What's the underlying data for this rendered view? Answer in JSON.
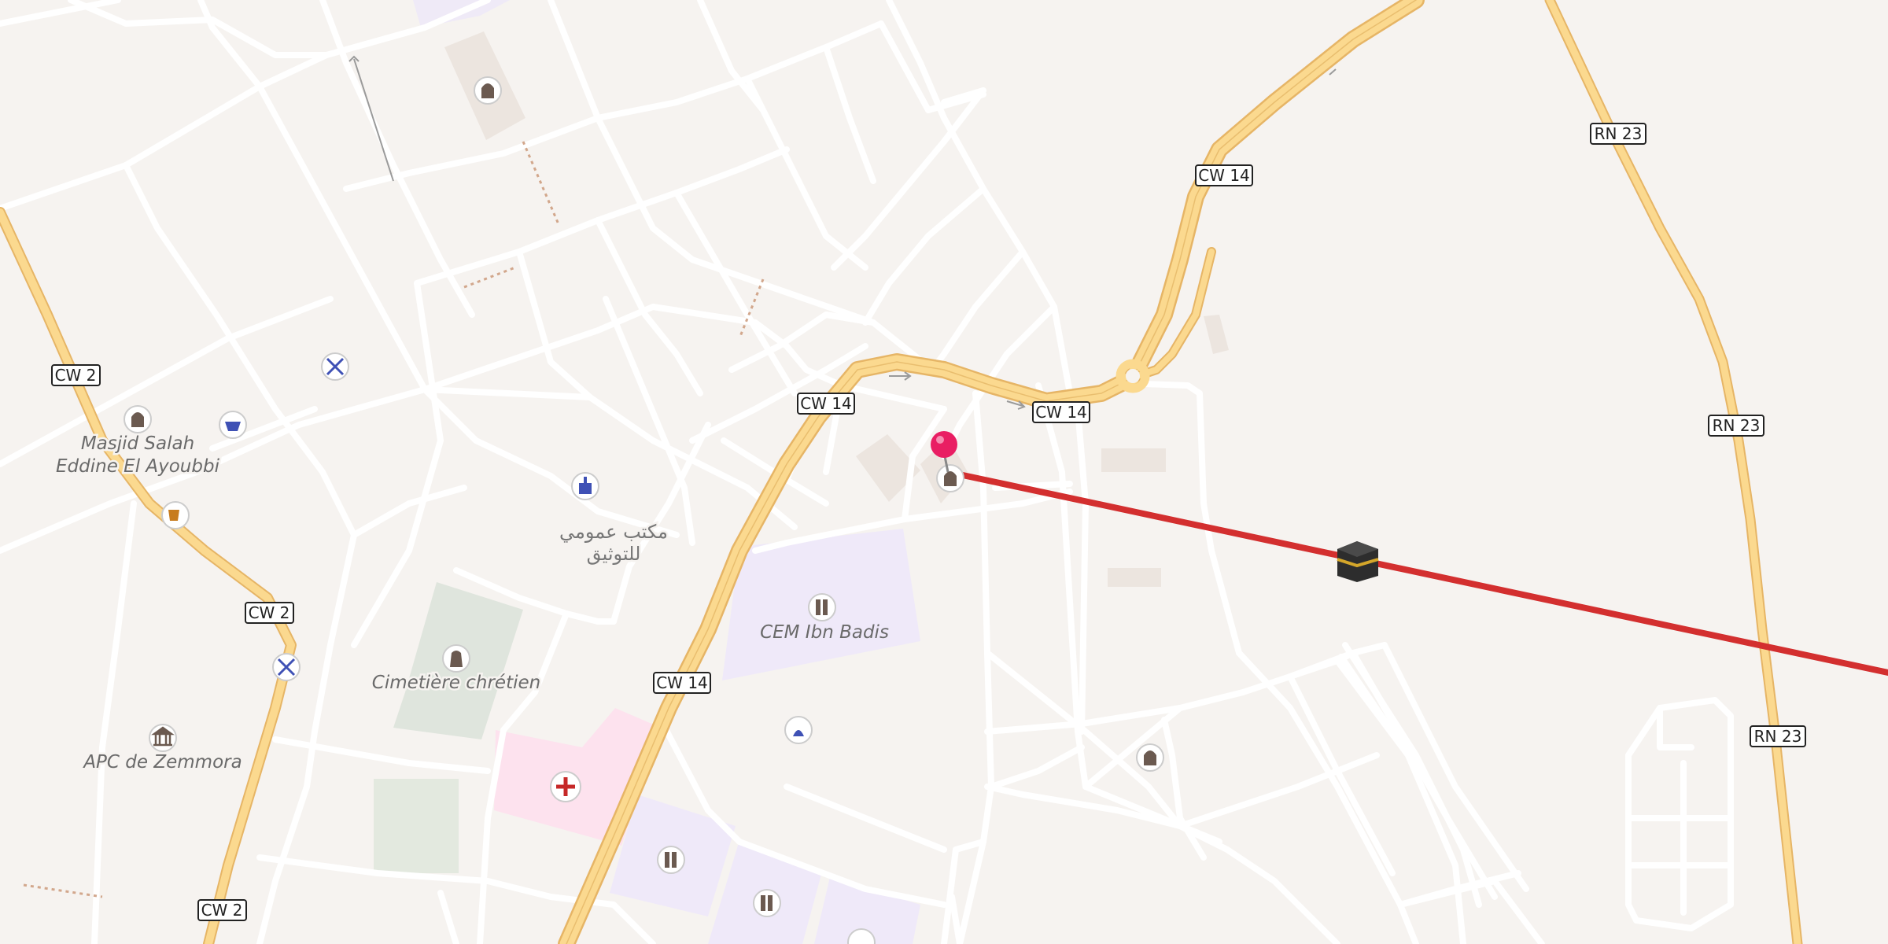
{
  "map": {
    "type": "street-map",
    "route_line_color": "#d32f2f",
    "pin_color": "#e91e63",
    "road_labels": {
      "cw2_a": "CW 2",
      "cw2_b": "CW 2",
      "cw2_c": "CW 2",
      "cw14_a": "CW 14",
      "cw14_b": "CW 14",
      "cw14_c": "CW 14",
      "cw14_d": "CW 14",
      "rn23_a": "RN 23",
      "rn23_b": "RN 23",
      "rn23_c": "RN 23"
    },
    "places": {
      "masjid_line1": "Masjid Salah",
      "masjid_line2": "Eddine El Ayoubbi",
      "office_line1": "مكتب عمومي",
      "office_line2": "للتوثيق",
      "school": "CEM Ibn Badis",
      "cemetery": "Cimetière chrétien",
      "apc": "APC de Zemmora"
    },
    "icons": {
      "kaaba": "kaaba-icon",
      "location_pin": "location-pin-icon",
      "hospital": "hospital-cross-icon"
    }
  }
}
